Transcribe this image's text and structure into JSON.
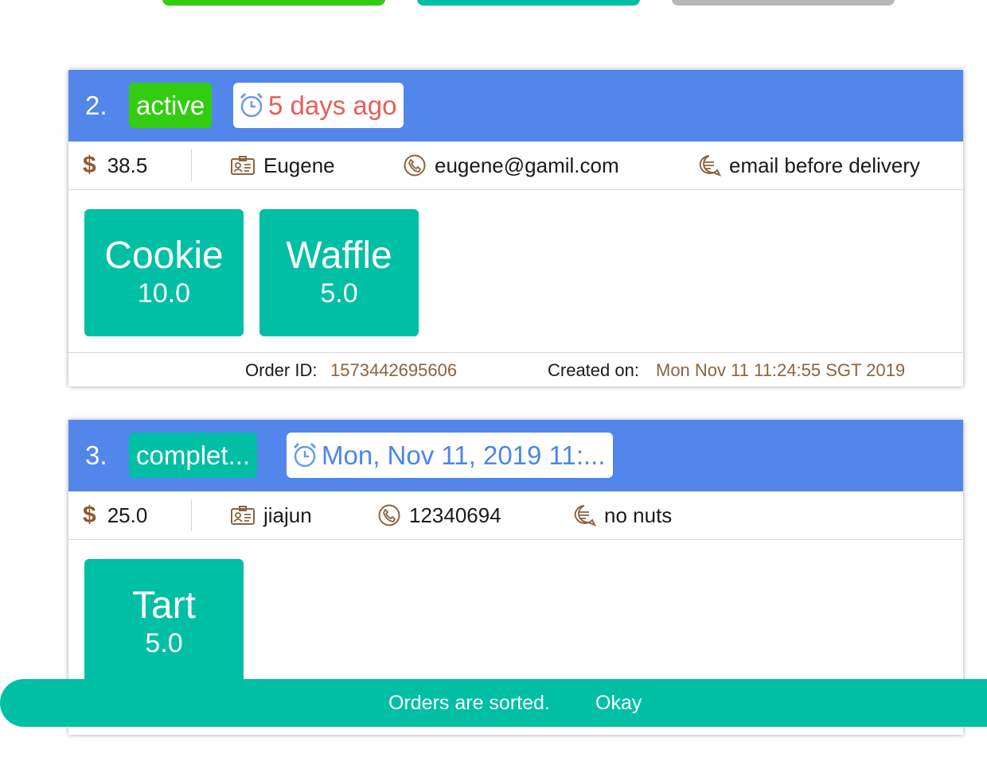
{
  "orders": [
    {
      "index": "2.",
      "status": "active",
      "time": "5 days ago",
      "price": "38.5",
      "customer": "Eugene",
      "contact": "eugene@gamil.com",
      "note": "email before delivery",
      "items": [
        {
          "name": "Cookie",
          "qty": "10.0"
        },
        {
          "name": "Waffle",
          "qty": "5.0"
        }
      ],
      "order_id_label": "Order ID:",
      "order_id": "1573442695606",
      "created_label": "Created on:",
      "created": "Mon Nov 11 11:24:55 SGT 2019"
    },
    {
      "index": "3.",
      "status": "complet...",
      "time": "Mon, Nov 11, 2019 11:...",
      "price": "25.0",
      "customer": "jiajun",
      "contact": "12340694",
      "note": "no nuts",
      "items": [
        {
          "name": "Tart",
          "qty": "5.0"
        }
      ]
    }
  ],
  "snackbar": {
    "message": "Orders are sorted.",
    "action": "Okay"
  },
  "colors": {
    "header": "#5286eb",
    "active": "#33cc11",
    "teal": "#00bfa5",
    "overdue_text": "#e55f5a",
    "time_text": "#4c86ea",
    "brown": "#8b6440"
  },
  "icons": [
    "dollar-icon",
    "customer-card-icon",
    "phone-icon",
    "comment-icon",
    "alarm-clock-icon"
  ]
}
